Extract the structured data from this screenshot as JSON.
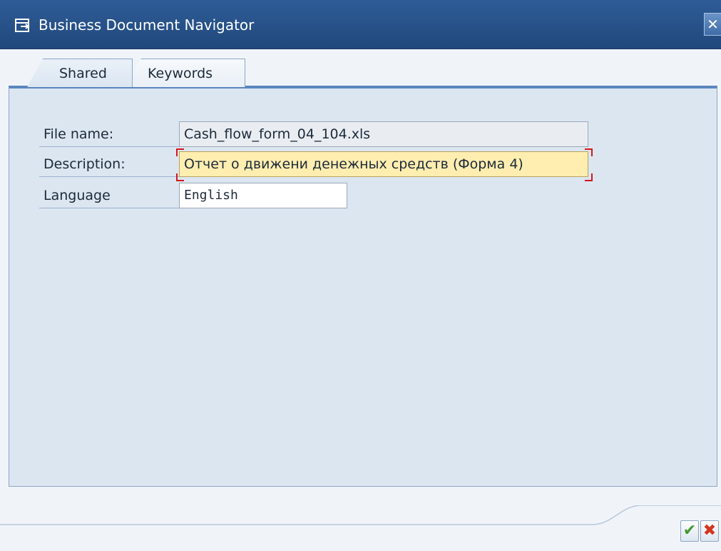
{
  "window": {
    "title": "Business Document Navigator",
    "close_glyph": "✕"
  },
  "tabs": [
    {
      "label": "Shared",
      "active": true
    },
    {
      "label": "Keywords",
      "active": false
    }
  ],
  "form": {
    "file_name": {
      "label": "File name:",
      "value": "Cash_flow_form_04_104.xls"
    },
    "description": {
      "label": "Description:",
      "value": "Отчет о движени денежных средств (Форма 4)",
      "required": true
    },
    "language": {
      "label": "Language",
      "value": "English"
    }
  },
  "footer": {
    "ok_glyph": "✔",
    "cancel_glyph": "✖"
  },
  "colors": {
    "titlebar": "#2f5c97",
    "panel": "#dce6f1",
    "required_field": "#ffeeb0",
    "ok": "#3f9a2a",
    "cancel": "#d6331f"
  }
}
